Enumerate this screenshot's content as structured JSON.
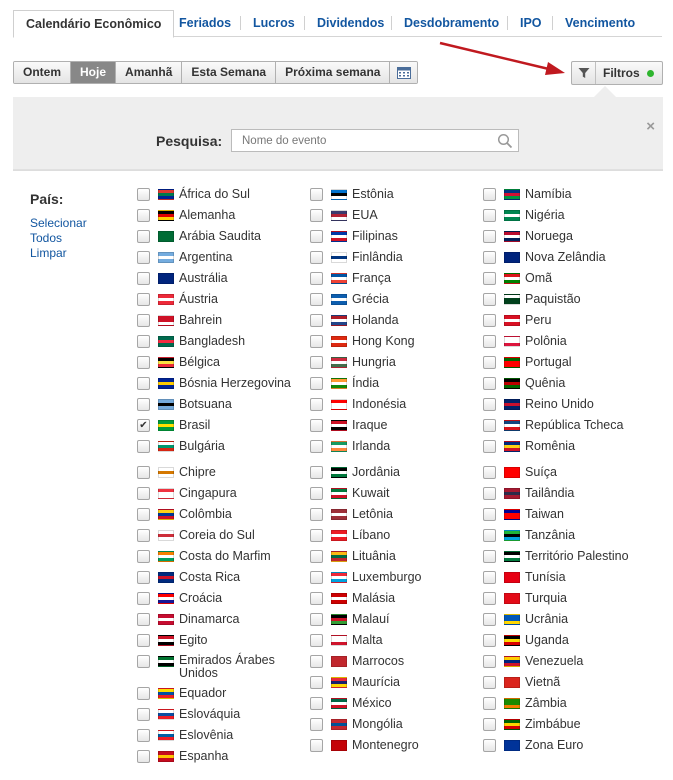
{
  "tabs": [
    {
      "label": "Calendário Econômico",
      "active": true
    },
    {
      "label": "Feriados"
    },
    {
      "label": "Lucros"
    },
    {
      "label": "Dividendos"
    },
    {
      "label": "Desdobramento"
    },
    {
      "label": "IPO"
    },
    {
      "label": "Vencimento"
    }
  ],
  "date_buttons": [
    {
      "label": "Ontem"
    },
    {
      "label": "Hoje",
      "active": true
    },
    {
      "label": "Amanhã"
    },
    {
      "label": "Esta Semana"
    },
    {
      "label": "Próxima semana"
    }
  ],
  "filters": {
    "label": "Filtros",
    "status_color": "#2eb52e"
  },
  "search": {
    "label": "Pesquisa:",
    "placeholder": "Nome do evento"
  },
  "country": {
    "label": "País:",
    "select_all": "Selecionar Todos",
    "select_all_line1": "Selecionar",
    "select_all_line2": "Todos",
    "clear": "Limpar"
  },
  "countries": {
    "col1": [
      {
        "name": "África do Sul",
        "flag": [
          "#de3831",
          "#007a4d",
          "#002395"
        ]
      },
      {
        "name": "Alemanha",
        "flag": [
          "#000000",
          "#dd0000",
          "#ffce00"
        ]
      },
      {
        "name": "Arábia Saudita",
        "flag": [
          "#006c35",
          "#006c35",
          "#006c35"
        ]
      },
      {
        "name": "Argentina",
        "flag": [
          "#74acdf",
          "#ffffff",
          "#74acdf"
        ]
      },
      {
        "name": "Austrália",
        "flag": [
          "#00247d",
          "#00247d",
          "#00247d"
        ]
      },
      {
        "name": "Áustria",
        "flag": [
          "#ed2939",
          "#ffffff",
          "#ed2939"
        ]
      },
      {
        "name": "Bahrein",
        "flag": [
          "#ce1126",
          "#ce1126",
          "#ffffff"
        ]
      },
      {
        "name": "Bangladesh",
        "flag": [
          "#006a4e",
          "#f42a41",
          "#006a4e"
        ]
      },
      {
        "name": "Bélgica",
        "flag": [
          "#000000",
          "#fae042",
          "#ed2939"
        ]
      },
      {
        "name": "Bósnia Herzegovina",
        "flag": [
          "#002395",
          "#fecb00",
          "#002395"
        ]
      },
      {
        "name": "Botsuana",
        "flag": [
          "#75aadb",
          "#000000",
          "#75aadb"
        ]
      },
      {
        "name": "Brasil",
        "flag": [
          "#009c3b",
          "#ffdf00",
          "#009c3b"
        ],
        "checked": true
      },
      {
        "name": "Bulgária",
        "flag": [
          "#ffffff",
          "#00966e",
          "#d62612"
        ]
      },
      {
        "name": "Chipre",
        "flag": [
          "#ffffff",
          "#d57800",
          "#ffffff"
        ]
      },
      {
        "name": "Cingapura",
        "flag": [
          "#ef3340",
          "#ffffff",
          "#ffffff"
        ]
      },
      {
        "name": "Colômbia",
        "flag": [
          "#fcd116",
          "#003893",
          "#ce1126"
        ]
      },
      {
        "name": "Coreia do Sul",
        "flag": [
          "#ffffff",
          "#cd2e3a",
          "#ffffff"
        ]
      },
      {
        "name": "Costa do Marfim",
        "flag": [
          "#f77f00",
          "#ffffff",
          "#009e60"
        ]
      },
      {
        "name": "Costa Rica",
        "flag": [
          "#002b7f",
          "#ce1126",
          "#002b7f"
        ]
      },
      {
        "name": "Croácia",
        "flag": [
          "#ff0000",
          "#ffffff",
          "#171796"
        ]
      },
      {
        "name": "Dinamarca",
        "flag": [
          "#c60c30",
          "#ffffff",
          "#c60c30"
        ]
      },
      {
        "name": "Egito",
        "flag": [
          "#ce1126",
          "#ffffff",
          "#000000"
        ]
      },
      {
        "name": "Emirados Árabes Unidos",
        "flag": [
          "#00732f",
          "#ffffff",
          "#000000"
        ],
        "two_line": true
      },
      {
        "name": "Equador",
        "flag": [
          "#ffdd00",
          "#034ea2",
          "#ed1c24"
        ]
      },
      {
        "name": "Eslováquia",
        "flag": [
          "#ffffff",
          "#0b4ea2",
          "#ee1c25"
        ]
      },
      {
        "name": "Eslovênia",
        "flag": [
          "#ffffff",
          "#005da4",
          "#ed1c24"
        ]
      },
      {
        "name": "Espanha",
        "flag": [
          "#c60b1e",
          "#ffc400",
          "#c60b1e"
        ]
      }
    ],
    "col2": [
      {
        "name": "Estônia",
        "flag": [
          "#0072ce",
          "#000000",
          "#ffffff"
        ]
      },
      {
        "name": "EUA",
        "flag": [
          "#3c3b6e",
          "#b22234",
          "#ffffff"
        ]
      },
      {
        "name": "Filipinas",
        "flag": [
          "#0038a8",
          "#ffffff",
          "#ce1126"
        ]
      },
      {
        "name": "Finlândia",
        "flag": [
          "#ffffff",
          "#003580",
          "#ffffff"
        ]
      },
      {
        "name": "França",
        "flag": [
          "#0055a4",
          "#ffffff",
          "#ef4135"
        ]
      },
      {
        "name": "Grécia",
        "flag": [
          "#0d5eaf",
          "#ffffff",
          "#0d5eaf"
        ]
      },
      {
        "name": "Holanda",
        "flag": [
          "#ae1c28",
          "#ffffff",
          "#21468b"
        ]
      },
      {
        "name": "Hong Kong",
        "flag": [
          "#de2910",
          "#ffffff",
          "#de2910"
        ]
      },
      {
        "name": "Hungria",
        "flag": [
          "#cd2a3e",
          "#ffffff",
          "#436f4d"
        ]
      },
      {
        "name": "Índia",
        "flag": [
          "#ff9933",
          "#ffffff",
          "#138808"
        ]
      },
      {
        "name": "Indonésia",
        "flag": [
          "#ff0000",
          "#ffffff",
          "#ffffff"
        ]
      },
      {
        "name": "Iraque",
        "flag": [
          "#ce1126",
          "#ffffff",
          "#000000"
        ]
      },
      {
        "name": "Irlanda",
        "flag": [
          "#169b62",
          "#ffffff",
          "#ff883e"
        ]
      },
      {
        "name": "Jordânia",
        "flag": [
          "#000000",
          "#ffffff",
          "#007a3d"
        ]
      },
      {
        "name": "Kuwait",
        "flag": [
          "#007a3d",
          "#ffffff",
          "#ce1126"
        ]
      },
      {
        "name": "Letônia",
        "flag": [
          "#9e3039",
          "#ffffff",
          "#9e3039"
        ]
      },
      {
        "name": "Líbano",
        "flag": [
          "#ed1c24",
          "#ffffff",
          "#ed1c24"
        ]
      },
      {
        "name": "Lituânia",
        "flag": [
          "#fdb913",
          "#006a44",
          "#c1272d"
        ]
      },
      {
        "name": "Luxemburgo",
        "flag": [
          "#ed2939",
          "#ffffff",
          "#00a1de"
        ]
      },
      {
        "name": "Malásia",
        "flag": [
          "#cc0001",
          "#ffffff",
          "#cc0001"
        ]
      },
      {
        "name": "Malauí",
        "flag": [
          "#000000",
          "#ce1126",
          "#339e35"
        ]
      },
      {
        "name": "Malta",
        "flag": [
          "#ffffff",
          "#ffffff",
          "#cf142b"
        ]
      },
      {
        "name": "Marrocos",
        "flag": [
          "#c1272d",
          "#c1272d",
          "#c1272d"
        ]
      },
      {
        "name": "Maurícia",
        "flag": [
          "#ea2839",
          "#1a206d",
          "#ffd500"
        ]
      },
      {
        "name": "México",
        "flag": [
          "#006847",
          "#ffffff",
          "#ce1126"
        ]
      },
      {
        "name": "Mongólia",
        "flag": [
          "#c4272f",
          "#015197",
          "#c4272f"
        ]
      },
      {
        "name": "Montenegro",
        "flag": [
          "#c40308",
          "#c40308",
          "#c40308"
        ]
      }
    ],
    "col3": [
      {
        "name": "Namíbia",
        "flag": [
          "#003580",
          "#d21034",
          "#009543"
        ]
      },
      {
        "name": "Nigéria",
        "flag": [
          "#008751",
          "#ffffff",
          "#008751"
        ]
      },
      {
        "name": "Noruega",
        "flag": [
          "#ba0c2f",
          "#ffffff",
          "#00205b"
        ]
      },
      {
        "name": "Nova Zelândia",
        "flag": [
          "#00247d",
          "#00247d",
          "#00247d"
        ]
      },
      {
        "name": "Omã",
        "flag": [
          "#db161b",
          "#ffffff",
          "#008000"
        ]
      },
      {
        "name": "Paquistão",
        "flag": [
          "#ffffff",
          "#01411c",
          "#01411c"
        ]
      },
      {
        "name": "Peru",
        "flag": [
          "#d91023",
          "#ffffff",
          "#d91023"
        ]
      },
      {
        "name": "Polônia",
        "flag": [
          "#ffffff",
          "#ffffff",
          "#dc143c"
        ]
      },
      {
        "name": "Portugal",
        "flag": [
          "#006600",
          "#ff0000",
          "#ff0000"
        ]
      },
      {
        "name": "Quênia",
        "flag": [
          "#000000",
          "#bb0000",
          "#006600"
        ]
      },
      {
        "name": "Reino Unido",
        "flag": [
          "#012169",
          "#c8102e",
          "#012169"
        ]
      },
      {
        "name": "República Tcheca",
        "flag": [
          "#11457e",
          "#ffffff",
          "#d7141a"
        ]
      },
      {
        "name": "Romênia",
        "flag": [
          "#002b7f",
          "#fcd116",
          "#ce1126"
        ]
      },
      {
        "name": "Suíça",
        "flag": [
          "#ff0000",
          "#ff0000",
          "#ff0000"
        ]
      },
      {
        "name": "Tailândia",
        "flag": [
          "#a51931",
          "#2d2a4a",
          "#a51931"
        ]
      },
      {
        "name": "Taiwan",
        "flag": [
          "#000095",
          "#fe0000",
          "#fe0000"
        ]
      },
      {
        "name": "Tanzânia",
        "flag": [
          "#1eb53a",
          "#000000",
          "#00a3dd"
        ]
      },
      {
        "name": "Território Palestino",
        "flag": [
          "#000000",
          "#ffffff",
          "#007a3d"
        ]
      },
      {
        "name": "Tunísia",
        "flag": [
          "#e70013",
          "#e70013",
          "#e70013"
        ]
      },
      {
        "name": "Turquia",
        "flag": [
          "#e30a17",
          "#e30a17",
          "#e30a17"
        ]
      },
      {
        "name": "Ucrânia",
        "flag": [
          "#0057b7",
          "#0057b7",
          "#ffd700"
        ]
      },
      {
        "name": "Uganda",
        "flag": [
          "#000000",
          "#fcdc04",
          "#d90000"
        ]
      },
      {
        "name": "Venezuela",
        "flag": [
          "#ffcc00",
          "#00247d",
          "#cf142b"
        ]
      },
      {
        "name": "Vietnã",
        "flag": [
          "#da251d",
          "#da251d",
          "#da251d"
        ]
      },
      {
        "name": "Zâmbia",
        "flag": [
          "#198a00",
          "#198a00",
          "#ef7d00"
        ]
      },
      {
        "name": "Zimbábue",
        "flag": [
          "#006400",
          "#ffd200",
          "#d40000"
        ]
      },
      {
        "name": "Zona Euro",
        "flag": [
          "#003399",
          "#003399",
          "#003399"
        ]
      }
    ]
  }
}
